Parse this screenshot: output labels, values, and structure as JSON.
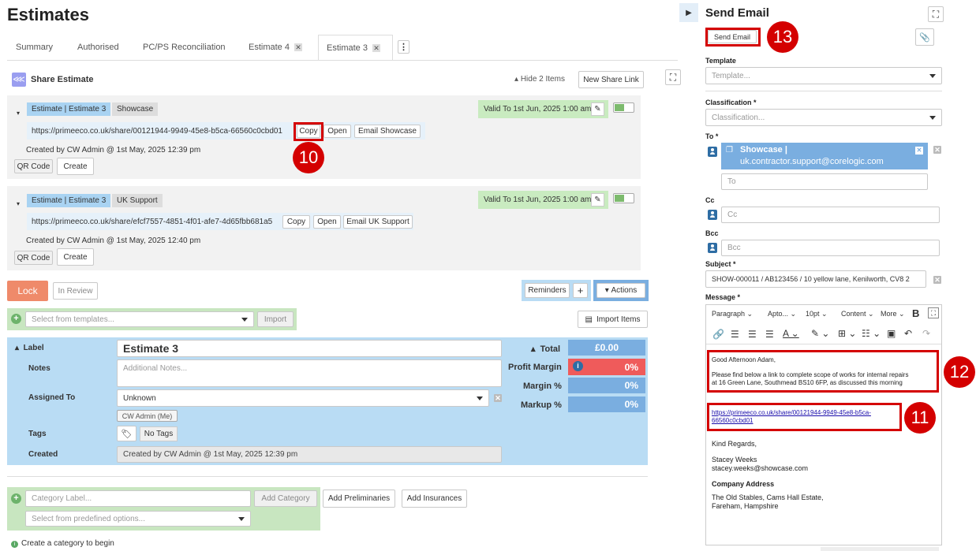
{
  "page": {
    "title": "Estimates"
  },
  "tabs": [
    {
      "label": "Summary"
    },
    {
      "label": "Authorised"
    },
    {
      "label": "PC/PS Reconciliation"
    },
    {
      "label": "Estimate 4"
    },
    {
      "label": "Estimate 3"
    }
  ],
  "share": {
    "title": "Share Estimate",
    "hide_items": "Hide 2 Items",
    "new_link": "New Share Link",
    "cards": [
      {
        "chip1": "Estimate | Estimate 3",
        "chip2": "Showcase",
        "valid": "Valid To 1st Jun, 2025 1:00 am",
        "url": "https://primeeco.co.uk/share/00121944-9949-45e8-b5ca-66560c0cbd01",
        "copy": "Copy",
        "open": "Open",
        "email": "Email Showcase",
        "created": "Created by CW Admin @ 1st May, 2025 12:39 pm",
        "qr": "QR Code",
        "create": "Create"
      },
      {
        "chip1": "Estimate | Estimate 3",
        "chip2": "UK Support",
        "valid": "Valid To 1st Jun, 2025 1:00 am",
        "url": "https://primeeco.co.uk/share/efcf7557-4851-4f01-afe7-4d65fbb681a5",
        "copy": "Copy",
        "open": "Open",
        "email": "Email UK Support",
        "created": "Created by CW Admin @ 1st May, 2025 12:40 pm",
        "qr": "QR Code",
        "create": "Create"
      }
    ]
  },
  "toolbar": {
    "lock": "Lock",
    "in_review": "In Review",
    "reminders": "Reminders",
    "plus": "+",
    "actions": "Actions",
    "templates_placeholder": "Select from templates...",
    "import": "Import",
    "import_items": "Import Items"
  },
  "estimate": {
    "label_label": "Label",
    "label_value": "Estimate 3",
    "notes_label": "Notes",
    "notes_placeholder": "Additional Notes...",
    "assigned_label": "Assigned To",
    "assigned_value": "Unknown",
    "assigned_chip": "CW Admin (Me)",
    "tags_label": "Tags",
    "tags_value": "No Tags",
    "created_label": "Created",
    "created_value": "Created by CW Admin @ 1st May, 2025 12:39 pm",
    "total_label": "Total",
    "total_value": "£0.00",
    "profit_margin_label": "Profit Margin",
    "profit_margin_value": "0%",
    "margin_label": "Margin %",
    "margin_value": "0%",
    "markup_label": "Markup %",
    "markup_value": "0%"
  },
  "category": {
    "label_placeholder": "Category Label...",
    "add_category": "Add Category",
    "add_preliminaries": "Add Preliminaries",
    "add_insurances": "Add Insurances",
    "predefined_placeholder": "Select from predefined options...",
    "hint": "Create a category to begin"
  },
  "email": {
    "title": "Send Email",
    "send_button": "Send Email",
    "template_label": "Template",
    "template_placeholder": "Template...",
    "classification_label": "Classification *",
    "classification_placeholder": "Classification...",
    "to_label": "To *",
    "to_chip_line1": "Showcase |",
    "to_chip_line2": "uk.contractor.support@corelogic.com",
    "to_placeholder": "To",
    "cc_label": "Cc",
    "cc_placeholder": "Cc",
    "bcc_label": "Bcc",
    "bcc_placeholder": "Bcc",
    "subject_label": "Subject *",
    "subject_value": "SHOW-000011 / AB123456 / 10 yellow lane, Kenilworth,  CV8 2",
    "message_label": "Message *",
    "editor": {
      "paragraph": "Paragraph",
      "font": "Apto...",
      "size": "10pt",
      "content": "Content",
      "more": "More",
      "bold": "B"
    },
    "body": {
      "greeting": "Good Afternoon Adam,",
      "line1": "Please find below a link to complete scope of works for internal repairs",
      "line2": "at 16 Green Lane, Southmead BS10 6FP, as discussed this morning",
      "link1": "https://primeeco.co.uk/share/00121944-9949-45e8-b5ca-",
      "link2": "66560c0cbd01",
      "regards": "Kind Regards,",
      "name": "Stacey Weeks",
      "email": "stacey.weeks@showcase.com",
      "company_heading": "Company Address",
      "address1": "The Old Stables, Cams Hall Estate,",
      "address2": "Fareham, Hampshire"
    }
  },
  "annotations": {
    "n10": "10",
    "n11": "11",
    "n12": "12",
    "n13": "13"
  },
  "colors": {
    "accent_blue": "#7aaee0",
    "panel_blue": "#b9dcf4",
    "lock_orange": "#ef8a6a",
    "green_panel": "#c8e6c0",
    "red_highlight": "#d40000",
    "profit_red": "#ef5b5b"
  }
}
